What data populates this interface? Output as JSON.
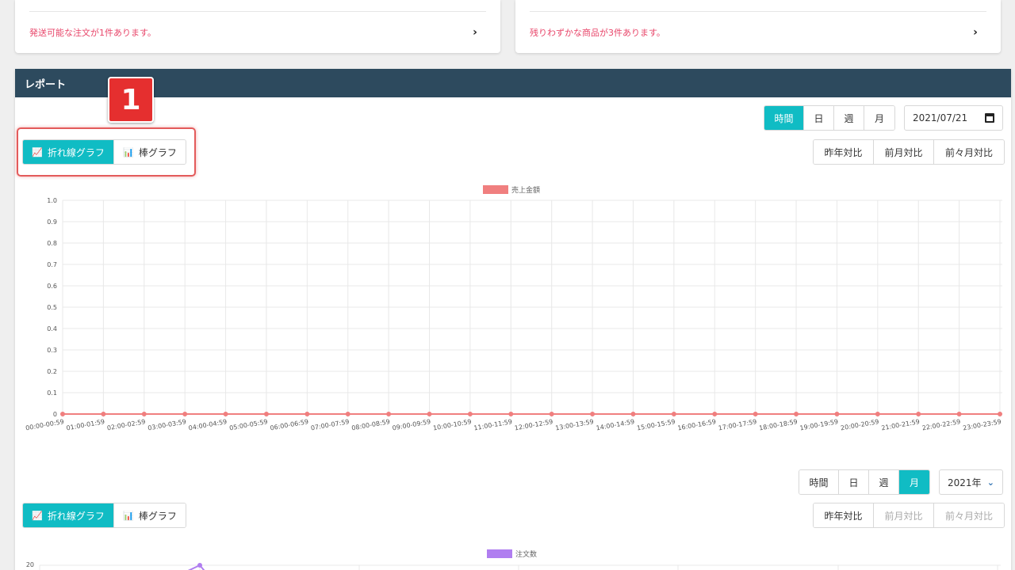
{
  "notices": {
    "shipping": "発送可能な注文が1件あります。",
    "low_stock": "残りわずかな商品が3件あります。"
  },
  "report": {
    "title": "レポート",
    "step_badge": "1"
  },
  "period_tabs": [
    "時間",
    "日",
    "週",
    "月"
  ],
  "chart_type_tabs": {
    "line": "折れ線グラフ",
    "bar": "棒グラフ"
  },
  "compare_tabs": [
    "昨年対比",
    "前月対比",
    "前々月対比"
  ],
  "top_controls": {
    "date_value": "2021/07/21",
    "active_period": "時間",
    "active_chart_type": "line"
  },
  "bottom_controls": {
    "year_value": "2021年",
    "active_period": "月",
    "active_chart_type": "line"
  },
  "colors": {
    "accent": "#10bcc4",
    "header": "#2d4a5e",
    "notice": "#e8466a",
    "sales_series": "#f07f7f",
    "orders_series": "#b07ef0",
    "highlight": "#e35b5b"
  },
  "chart_data": [
    {
      "type": "line",
      "series": [
        {
          "name": "売上金額",
          "values": [
            0,
            0,
            0,
            0,
            0,
            0,
            0,
            0,
            0,
            0,
            0,
            0,
            0,
            0,
            0,
            0,
            0,
            0,
            0,
            0,
            0,
            0,
            0,
            0
          ]
        }
      ],
      "categories": [
        "00:00-00:59",
        "01:00-01:59",
        "02:00-02:59",
        "03:00-03:59",
        "04:00-04:59",
        "05:00-05:59",
        "06:00-06:59",
        "07:00-07:59",
        "08:00-08:59",
        "09:00-09:59",
        "10:00-10:59",
        "11:00-11:59",
        "12:00-12:59",
        "13:00-13:59",
        "14:00-14:59",
        "15:00-15:59",
        "16:00-16:59",
        "17:00-17:59",
        "18:00-18:59",
        "19:00-19:59",
        "20:00-20:59",
        "21:00-21:59",
        "22:00-22:59",
        "23:00-23:59"
      ],
      "yticks": [
        "0",
        "0.1",
        "0.2",
        "0.3",
        "0.4",
        "0.5",
        "0.6",
        "0.7",
        "0.8",
        "0.9",
        "1.0"
      ],
      "ylim": [
        0,
        1
      ],
      "grid": true,
      "legend": "top-center"
    },
    {
      "type": "line",
      "series": [
        {
          "name": "注文数"
        }
      ],
      "yticks": [
        "20"
      ],
      "grid": true,
      "legend": "top-center"
    }
  ]
}
